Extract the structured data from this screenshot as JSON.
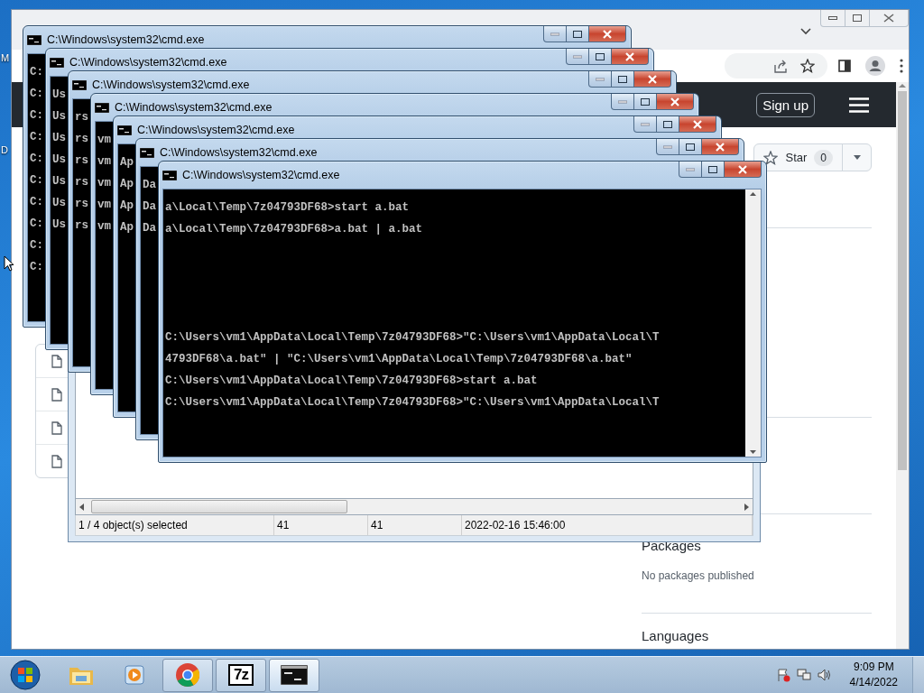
{
  "desktop": {
    "icon_labels": [
      "M",
      "D"
    ]
  },
  "browser": {
    "header": {
      "sign_up": "Sign up"
    },
    "star_button": {
      "label": "Star",
      "count": "0"
    },
    "sidebar": [
      {
        "heading": "Packages",
        "text": "No packages published"
      },
      {
        "heading": "Languages"
      }
    ]
  },
  "archive_window": {
    "status_bar": [
      "1 / 4 object(s) selected",
      "41",
      "41",
      "2022-02-16 15:46:00"
    ]
  },
  "cmd_windows": [
    {
      "title": "C:\\Windows\\system32\\cmd.exe",
      "lines": [
        "C:",
        "C:",
        "C:",
        "C:",
        "C:",
        "C:",
        "C:",
        "C:",
        "C:",
        "C:"
      ]
    },
    {
      "title": "C:\\Windows\\system32\\cmd.exe",
      "lines": [
        "Us",
        "Us",
        "Us",
        "Us",
        "Us",
        "Us",
        "Us"
      ]
    },
    {
      "title": "C:\\Windows\\system32\\cmd.exe",
      "lines": [
        "rs",
        "rs",
        "rs",
        "rs",
        "rs",
        "rs"
      ]
    },
    {
      "title": "C:\\Windows\\system32\\cmd.exe",
      "lines": [
        "vm",
        "vm",
        "vm",
        "vm",
        "vm"
      ]
    },
    {
      "title": "C:\\Windows\\system32\\cmd.exe",
      "lines": [
        "Ap",
        "Ap",
        "Ap",
        "Ap"
      ]
    },
    {
      "title": "C:\\Windows\\system32\\cmd.exe",
      "lines": [
        "Da",
        "Da",
        "Da"
      ]
    },
    {
      "title": "C:\\Windows\\system32\\cmd.exe",
      "lines": [
        "a\\Local\\Temp\\7z04793DF68>start a.bat",
        "a\\Local\\Temp\\7z04793DF68>a.bat | a.bat"
      ],
      "lower_lines": [
        "C:\\Users\\vm1\\AppData\\Local\\Temp\\7z04793DF68>\"C:\\Users\\vm1\\AppData\\Local\\T",
        "4793DF68\\a.bat\" | \"C:\\Users\\vm1\\AppData\\Local\\Temp\\7z04793DF68\\a.bat\"",
        "C:\\Users\\vm1\\AppData\\Local\\Temp\\7z04793DF68>start a.bat",
        "C:\\Users\\vm1\\AppData\\Local\\Temp\\7z04793DF68>\"C:\\Users\\vm1\\AppData\\Local\\T"
      ]
    }
  ],
  "taskbar": {
    "apps": [
      {
        "kind": "explorer",
        "running": false,
        "selected": false
      },
      {
        "kind": "media",
        "running": false,
        "selected": false
      },
      {
        "kind": "chrome",
        "running": true,
        "selected": false
      },
      {
        "kind": "sevenzip",
        "running": true,
        "selected": false,
        "icon_text": "7z"
      },
      {
        "kind": "console",
        "running": true,
        "selected": true
      }
    ],
    "clock": {
      "time": "9:09 PM",
      "date": "4/14/2022"
    }
  }
}
